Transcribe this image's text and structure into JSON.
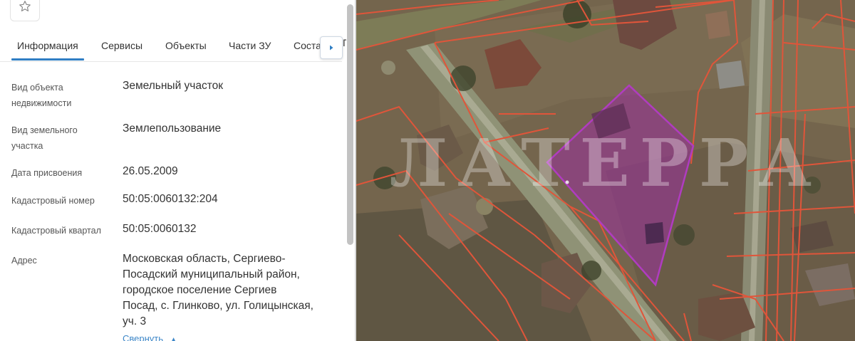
{
  "panel": {
    "tabs": [
      {
        "label": "Информация",
        "active": true
      },
      {
        "label": "Сервисы",
        "active": false
      },
      {
        "label": "Объекты",
        "active": false
      },
      {
        "label": "Части ЗУ",
        "active": false
      },
      {
        "label": "Состав",
        "active": false
      }
    ],
    "tab_edge_glyph": "Г",
    "fields": {
      "object_type": {
        "label": [
          "Вид объекта",
          "недвижимости"
        ],
        "value": "Земельный участок"
      },
      "parcel_type": {
        "label": [
          "Вид земельного",
          "участка"
        ],
        "value": "Землепользование"
      },
      "assigned_date": {
        "label": "Дата присвоения",
        "value": "26.05.2009"
      },
      "cadastral_number": {
        "label": "Кадастровый номер",
        "value": "50:05:0060132:204"
      },
      "cadastral_quarter": {
        "label": "Кадастровый квартал",
        "value": "50:05:0060132"
      },
      "address": {
        "label": "Адрес",
        "value_lines": [
          "Московская область, Сергиево-",
          "Посадский муниципальный район,",
          "городское поселение Сергиев",
          "Посад, с. Глинково, ул. Голицынская,",
          "уч. 3"
        ]
      }
    },
    "collapse_label": "Свернуть",
    "collapse_icon": "chevron-up-icon",
    "star_icon": "star-outline-icon",
    "next_icon": "caret-right-icon"
  },
  "map": {
    "watermark": "ЛАТЕРРА",
    "colors": {
      "boundary": "#e0553a",
      "selected_fill": "#9b2f9e",
      "selected_stroke": "#b03cc0",
      "accent": "#2f7ec4"
    }
  }
}
